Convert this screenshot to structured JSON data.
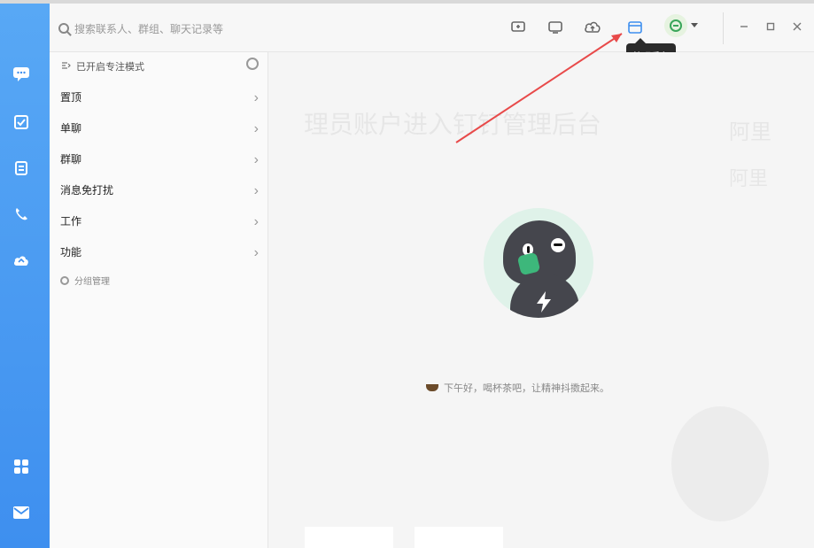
{
  "topbar": {
    "search_placeholder": "搜索联系人、群组、聊天记录等",
    "tooltip_text": "管理后台"
  },
  "list": {
    "focus_mode_label": "已开启专注模式",
    "items": [
      {
        "label": "置顶"
      },
      {
        "label": "单聊"
      },
      {
        "label": "群聊"
      },
      {
        "label": "消息免打扰"
      },
      {
        "label": "工作"
      },
      {
        "label": "功能"
      }
    ],
    "manage_label": "分组管理"
  },
  "content": {
    "greeting": "下午好，喝杯茶吧，让精神抖擞起来。",
    "background_faint_title": "理员账户进入钉钉管理后台",
    "background_faint_right_1": "阿里",
    "background_faint_right_2": "阿里"
  },
  "colors": {
    "sidebar_top": "#58a8f5",
    "sidebar_bottom": "#3e8fef",
    "arrow_red": "#e84a4a",
    "tooltip_bg": "#2b2b2b"
  },
  "icons": {
    "sidebar": [
      "chat-icon",
      "docs-icon",
      "contacts-icon",
      "phone-icon",
      "cloud-icon",
      "apps-icon",
      "mail-icon"
    ],
    "toolbar": [
      "new-chat-icon",
      "screen-icon",
      "cloud-upload-icon",
      "admin-console-icon"
    ]
  }
}
